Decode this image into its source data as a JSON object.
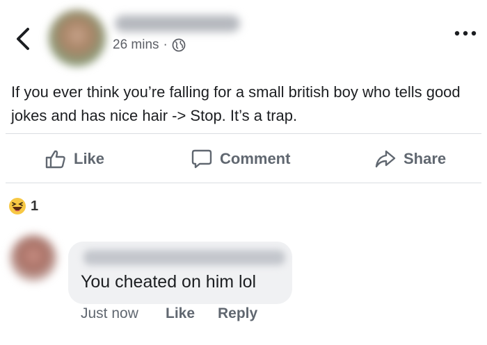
{
  "post": {
    "timestamp": "26 mins",
    "separator": "·",
    "text": "If you ever think you’re falling for a small british boy who tells good jokes and has nice hair -> Stop. It’s a trap."
  },
  "actions": {
    "like": "Like",
    "comment": "Comment",
    "share": "Share"
  },
  "reactions": {
    "count": "1",
    "icon": "laugh-emoji-icon"
  },
  "comment": {
    "text": "You cheated on him lol",
    "time": "Just now",
    "like": "Like",
    "reply": "Reply"
  },
  "colors": {
    "text": "#1c1e21",
    "muted": "#606770",
    "bubble": "#f0f1f3",
    "divider": "#dadde1",
    "laugh": "#f7c844"
  }
}
